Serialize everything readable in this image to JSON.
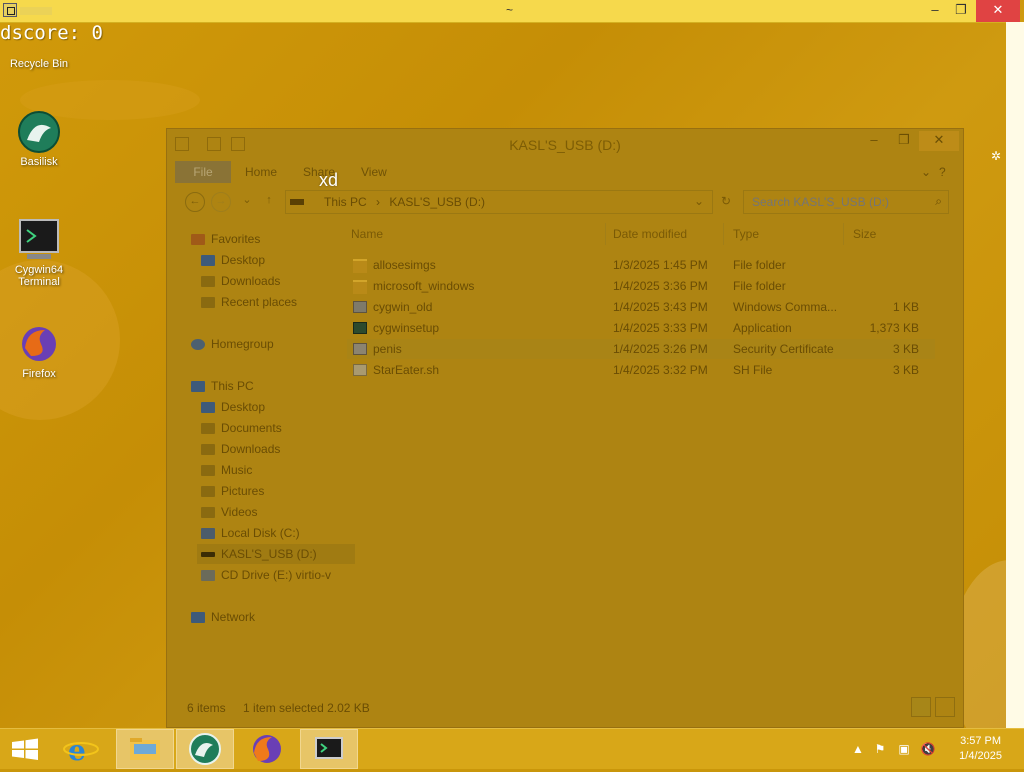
{
  "overlay_window": {
    "title": "~",
    "score_text": "dscore: 0",
    "floating_text": "xd",
    "controls": {
      "minimize": "–",
      "maximize": "❐",
      "close": "✕"
    }
  },
  "desktop": {
    "icons": [
      {
        "label": "Recycle Bin"
      },
      {
        "label": "Basilisk"
      },
      {
        "label": "Cygwin64 Terminal"
      },
      {
        "label": "Firefox"
      }
    ]
  },
  "explorer": {
    "title": "KASL'S_USB (D:)",
    "tabs": [
      "File",
      "Home",
      "Share",
      "View"
    ],
    "breadcrumb": [
      "This PC",
      "KASL'S_USB (D:)"
    ],
    "search_placeholder": "Search KASL'S_USB (D:)",
    "nav_pane": {
      "favorites_label": "Favorites",
      "favorites": [
        "Desktop",
        "Downloads",
        "Recent places"
      ],
      "homegroup_label": "Homegroup",
      "thispc_label": "This PC",
      "thispc": [
        "Desktop",
        "Documents",
        "Downloads",
        "Music",
        "Pictures",
        "Videos",
        "Local Disk (C:)",
        "KASL'S_USB (D:)",
        "CD Drive (E:) virtio-v"
      ],
      "network_label": "Network"
    },
    "columns": [
      "Name",
      "Date modified",
      "Type",
      "Size"
    ],
    "files": [
      {
        "name": "allosesimgs",
        "date": "1/3/2025 1:45 PM",
        "type": "File folder",
        "size": ""
      },
      {
        "name": "microsoft_windows",
        "date": "1/4/2025 3:36 PM",
        "type": "File folder",
        "size": ""
      },
      {
        "name": "cygwin_old",
        "date": "1/4/2025 3:43 PM",
        "type": "Windows Comma...",
        "size": "1 KB"
      },
      {
        "name": "cygwinsetup",
        "date": "1/4/2025 3:33 PM",
        "type": "Application",
        "size": "1,373 KB"
      },
      {
        "name": "penis",
        "date": "1/4/2025 3:26 PM",
        "type": "Security Certificate",
        "size": "3 KB"
      },
      {
        "name": "StarEater.sh",
        "date": "1/4/2025 3:32 PM",
        "type": "SH File",
        "size": "3 KB"
      }
    ],
    "status": {
      "items": "6 items",
      "selected": "1 item selected  2.02 KB"
    }
  },
  "taskbar": {
    "time": "3:57 PM",
    "date": "1/4/2025"
  },
  "colors": {
    "overlay_bar": "#f6d94c",
    "wallpaper": "#c9960a",
    "close_red": "#e04343"
  }
}
